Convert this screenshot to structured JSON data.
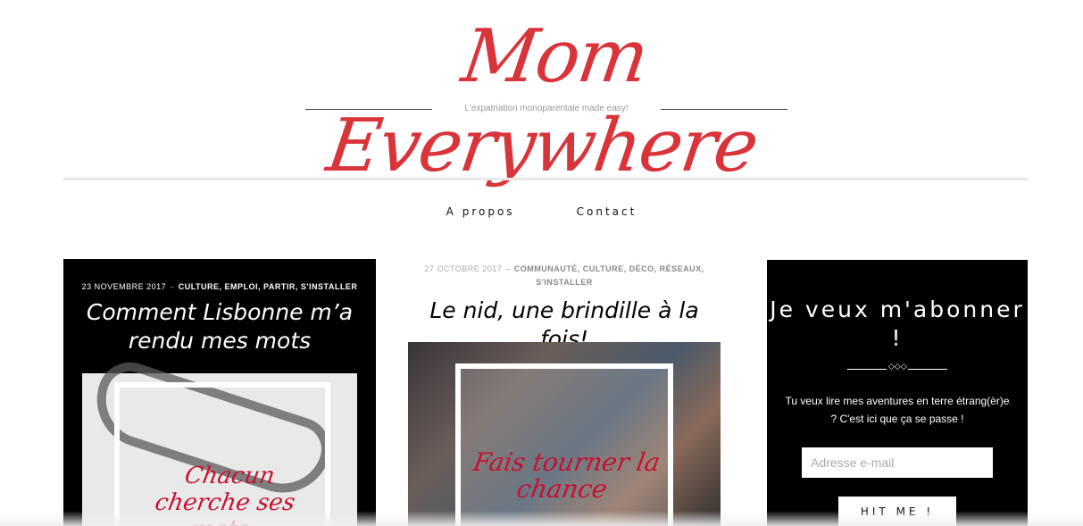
{
  "site": {
    "title": "Mom Everywhere",
    "tagline": "L'expatriation monoparentale made easy!"
  },
  "nav": {
    "items": [
      {
        "label": "A propos"
      },
      {
        "label": "Contact"
      }
    ]
  },
  "posts": [
    {
      "date": "23 novembre 2017",
      "separator": "–",
      "categories": "CULTURE, EMPLOI, PARTIR, S'INSTALLER",
      "title": "Comment Lisbonne m’a rendu mes mots",
      "thumb_caption": "Chacun cherche ses mots"
    },
    {
      "date": "27 octobre 2017",
      "separator": "–",
      "categories": "COMMUNAUTÉ, CULTURE, DÉCO, RÉSEAUX, S'INSTALLER",
      "title": "Le nid, une brindille à la fois!",
      "thumb_caption": "Fais tourner la chance"
    }
  ],
  "subscribe": {
    "title": "Je veux m'abonner !",
    "ornament": "◇◇◇",
    "text": "Tu veux lire mes aventures en terre étrang(èr)e ? C'est ici que ça se passe !",
    "email_placeholder": "Adresse e-mail",
    "button_label": "HIT ME !"
  },
  "colors": {
    "brand_red": "#d9343a",
    "dark": "#000000"
  }
}
